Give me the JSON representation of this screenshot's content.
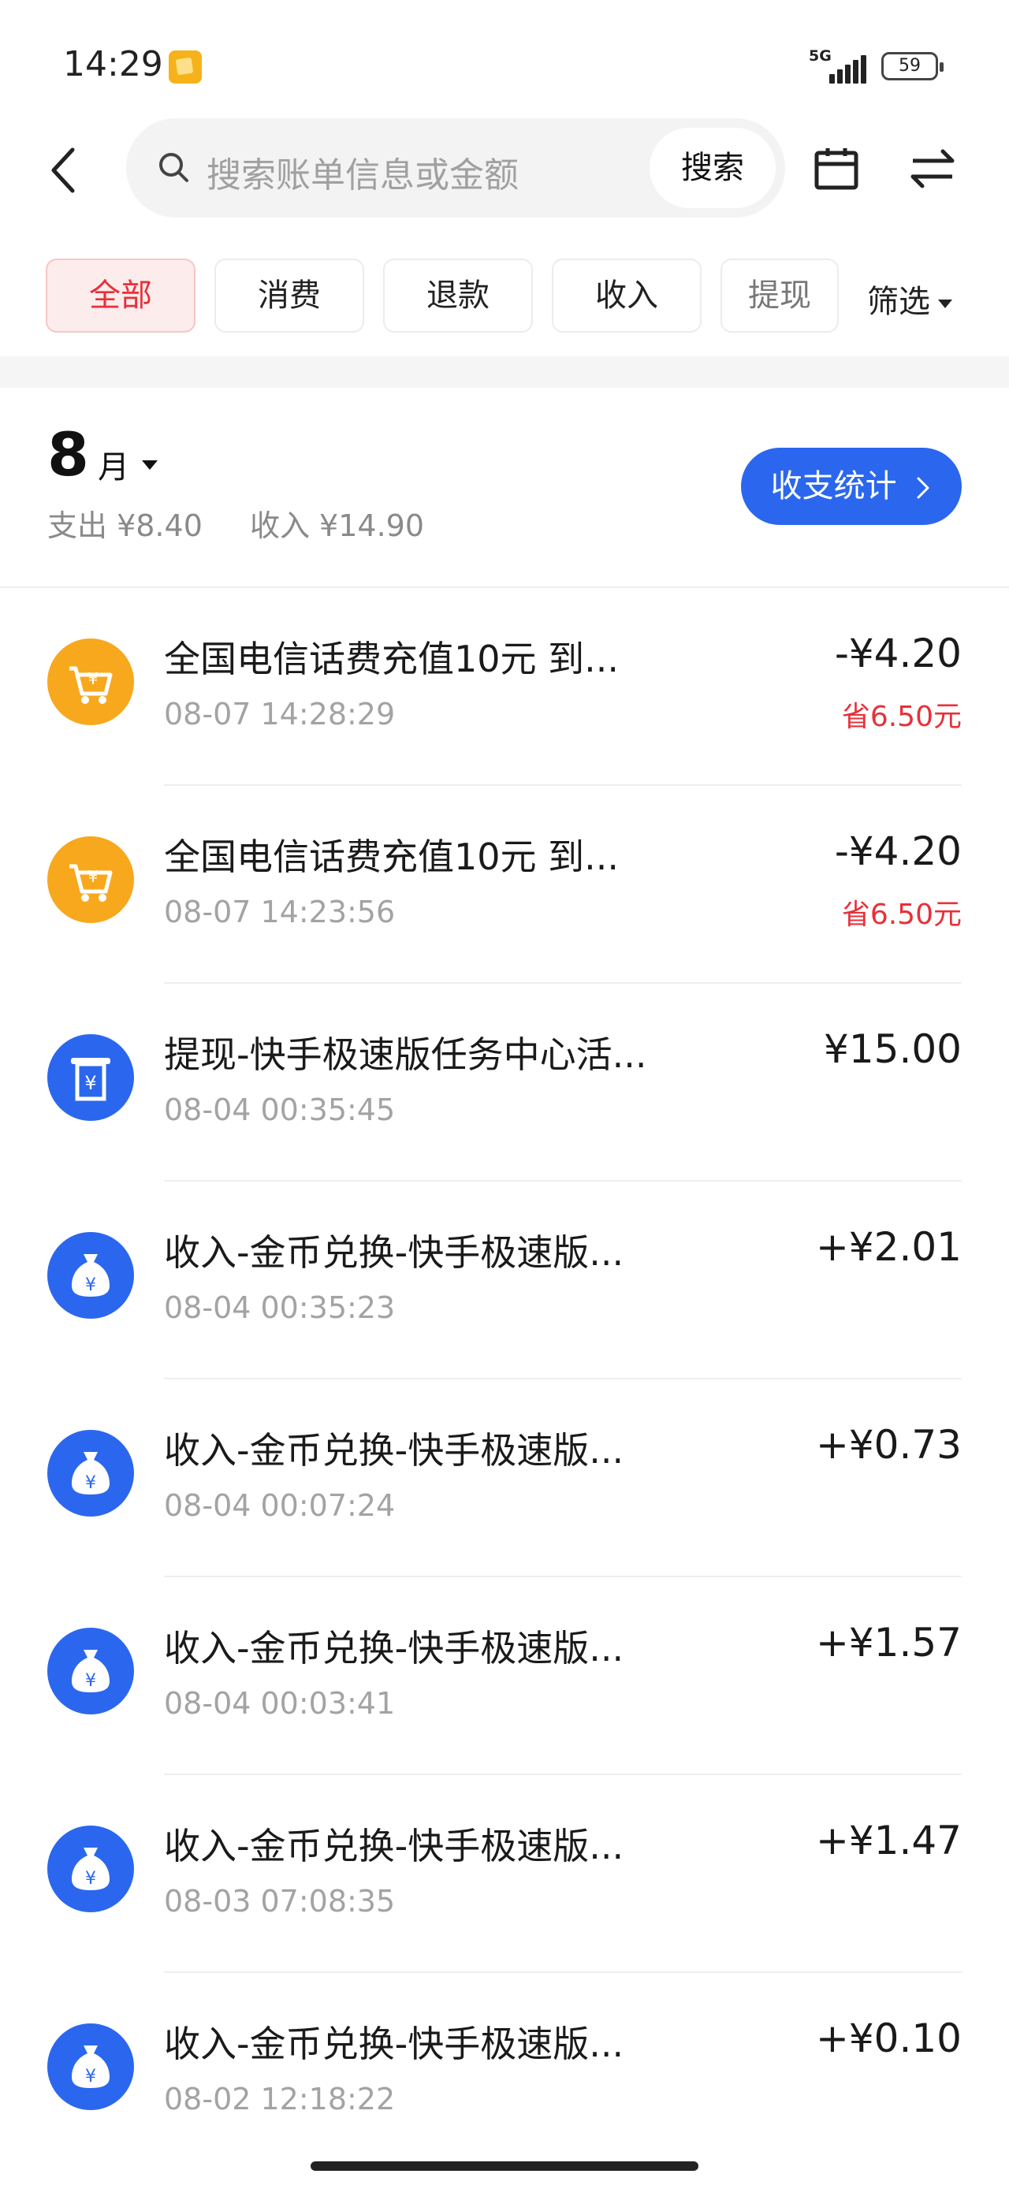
{
  "status_bar": {
    "time": "14:29",
    "network": "5G",
    "battery": "59"
  },
  "search": {
    "placeholder": "搜索账单信息或金额",
    "button_label": "搜索"
  },
  "tabs": [
    {
      "label": "全部",
      "active": true
    },
    {
      "label": "消费",
      "active": false
    },
    {
      "label": "退款",
      "active": false
    },
    {
      "label": "收入",
      "active": false
    },
    {
      "label": "提现",
      "active": false
    }
  ],
  "filter_label": "筛选",
  "month_header": {
    "month": "8",
    "unit": "月",
    "expense": "支出 ¥8.40",
    "income": "收入 ¥14.90",
    "stat_button": "收支统计"
  },
  "transactions": [
    {
      "icon": "cart-icon",
      "title": "全国电信话费充值10元  到...",
      "time": "08-07 14:28:29",
      "amount": "-¥4.20",
      "save": "省6.50元"
    },
    {
      "icon": "cart-icon",
      "title": "全国电信话费充值10元  到...",
      "time": "08-07 14:23:56",
      "amount": "-¥4.20",
      "save": "省6.50元"
    },
    {
      "icon": "atm-withdraw-icon",
      "title": "提现-快手极速版任务中心活...",
      "time": "08-04 00:35:45",
      "amount": "¥15.00",
      "save": ""
    },
    {
      "icon": "money-bag-icon",
      "title": "收入-金币兑换-快手极速版...",
      "time": "08-04 00:35:23",
      "amount": "+¥2.01",
      "save": ""
    },
    {
      "icon": "money-bag-icon",
      "title": "收入-金币兑换-快手极速版...",
      "time": "08-04 00:07:24",
      "amount": "+¥0.73",
      "save": ""
    },
    {
      "icon": "money-bag-icon",
      "title": "收入-金币兑换-快手极速版...",
      "time": "08-04 00:03:41",
      "amount": "+¥1.57",
      "save": ""
    },
    {
      "icon": "money-bag-icon",
      "title": "收入-金币兑换-快手极速版...",
      "time": "08-03 07:08:35",
      "amount": "+¥1.47",
      "save": ""
    },
    {
      "icon": "money-bag-icon",
      "title": "收入-金币兑换-快手极速版...",
      "time": "08-02 12:18:22",
      "amount": "+¥0.10",
      "save": ""
    }
  ],
  "colors": {
    "accent_blue": "#2b67ee",
    "accent_red": "#e8303a",
    "cart_orange": "#f8a81d"
  }
}
